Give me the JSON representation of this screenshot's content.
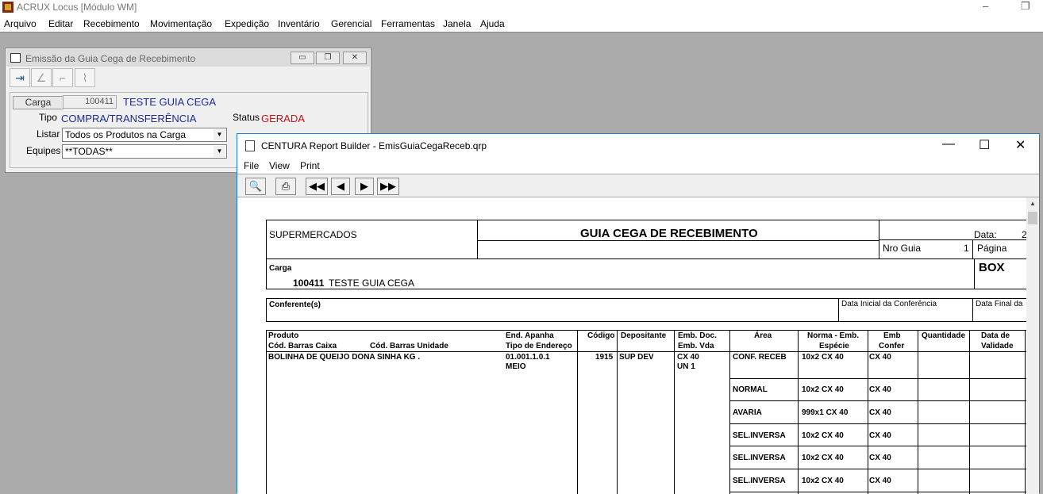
{
  "app": {
    "title": "ACRUX Locus [Módulo WM]",
    "minimize_glyph": "‒",
    "restore_glyph": "❐",
    "icon": "app-icon"
  },
  "menu": [
    "Arquivo",
    "Editar",
    "Recebimento",
    "Movimentação",
    "Expedição",
    "Inventário",
    "Gerencial",
    "Ferramentas",
    "Janela",
    "Ajuda"
  ],
  "dialog": {
    "title": "Emissão da Guia Cega de Recebimento",
    "carga_button": "Carga",
    "carga_number": "100411",
    "carga_name": "TESTE GUIA CEGA",
    "tipo_label": "Tipo",
    "tipo_value": "COMPRA/TRANSFERÊNCIA",
    "status_label": "Status",
    "status_value": "GERADA",
    "listar_label": "Listar",
    "listar_value": "Todos os Produtos na Carga",
    "equipes_label": "Equipes",
    "equipes_value": "**TODAS**"
  },
  "report_window": {
    "title": "CENTURA Report Builder - EmisGuiaCegaReceb.qrp",
    "menu": [
      "File",
      "View",
      "Print"
    ]
  },
  "report": {
    "company": "SUPERMERCADOS",
    "title": "GUIA CEGA DE RECEBIMENTO",
    "data_label": "Data:",
    "data_value": "2",
    "nro_guia_label": "Nro Guia",
    "nro_guia_value": "1",
    "pagina_label": "Página",
    "carga_label": "Carga",
    "carga_number": "100411",
    "carga_name": "TESTE GUIA CEGA",
    "box_label": "BOX",
    "conferente_label": "Conferente(s)",
    "data_inicial_label": "Data Inicial da Conferência",
    "data_final_label": "Data Final da",
    "col_produto": "Produto",
    "col_cod_barras_caixa": "Cód. Barras Caixa",
    "col_cod_barras_unidade": "Cód. Barras Unidade",
    "col_end_apanha": "End. Apanha",
    "col_tipo_endereco": "Tipo de Endereço",
    "col_codigo": "Código",
    "col_depositante": "Depositante",
    "col_emb_doc": "Emb. Doc.",
    "col_emb_vda": "Emb. Vda",
    "col_area": "Área",
    "col_norma_emb": "Norma - Emb.",
    "col_especie": "Espécie",
    "col_emb": "Emb",
    "col_confer": "Confer",
    "col_quantidade": "Quantidade",
    "col_data_de": "Data de",
    "col_validade": "Validade",
    "item": {
      "produto": "BOLINHA DE QUEIJO DONA SINHA KG .",
      "end_apanha": "01.001.1.0.1",
      "tipo_endereco": "MEIO",
      "codigo": "1915",
      "depositante": "SUP DEV",
      "emb_doc": "CX 40",
      "emb_vda": "UN 1"
    },
    "rows": [
      {
        "area": "CONF. RECEB",
        "norma": "10x2 CX 40",
        "emb_confer": "CX 40"
      },
      {
        "area": "NORMAL",
        "norma": "10x2 CX 40",
        "emb_confer": "CX 40"
      },
      {
        "area": "AVARIA",
        "norma": "999x1 CX 40",
        "emb_confer": "CX 40"
      },
      {
        "area": "SEL.INVERSA",
        "norma": "10x2 CX 40",
        "emb_confer": "CX 40"
      },
      {
        "area": "SEL.INVERSA",
        "norma": "10x2 CX 40",
        "emb_confer": "CX 40"
      },
      {
        "area": "SEL.INVERSA",
        "norma": "10x2 CX 40",
        "emb_confer": "CX 40"
      }
    ]
  }
}
